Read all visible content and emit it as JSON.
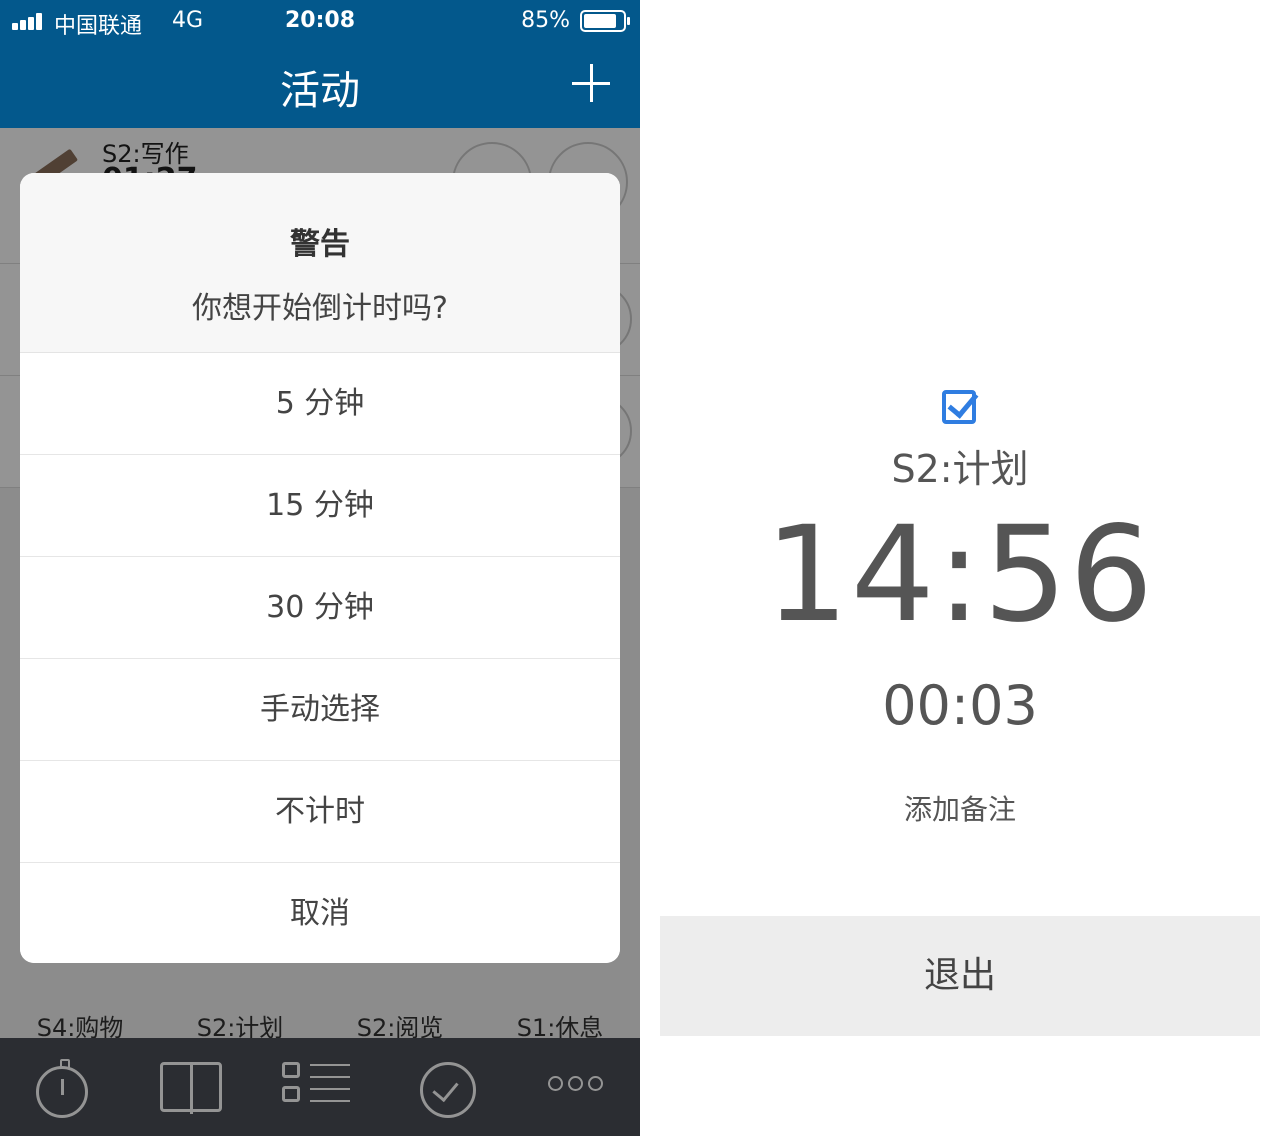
{
  "left": {
    "statusbar": {
      "carrier": "中国联通",
      "network": "4G",
      "time": "20:08",
      "battery_percent": "85%",
      "battery_level": 0.85
    },
    "navbar": {
      "title": "活动",
      "add_icon": "plus-icon"
    },
    "running": {
      "name": "S2:写作",
      "time": "01:27"
    },
    "grid": [
      {
        "label": "S4:购物",
        "icon": "shopping-icon"
      },
      {
        "label": "S2:计划",
        "icon": "plan-icon"
      },
      {
        "label": "S2:阅览",
        "icon": "read-icon"
      },
      {
        "label": "S1:休息",
        "icon": "cup-icon"
      }
    ],
    "tabbar": [
      "stopwatch-icon",
      "book-icon",
      "list-icon",
      "check-circle-icon",
      "more-icon"
    ],
    "dialog": {
      "title": "警告",
      "message": "你想开始倒计时吗?",
      "options": [
        "5 分钟",
        "15 分钟",
        "30 分钟",
        "手动选择",
        "不计时",
        "取消"
      ]
    },
    "colors": {
      "nav": "#03588c",
      "tabbar": "#4a4f57"
    }
  },
  "right": {
    "activity": "S2:计划",
    "countdown": "14:56",
    "elapsed": "00:03",
    "add_note": "添加备注",
    "exit": "退出",
    "colors": {
      "check": "#2f7de1"
    }
  }
}
